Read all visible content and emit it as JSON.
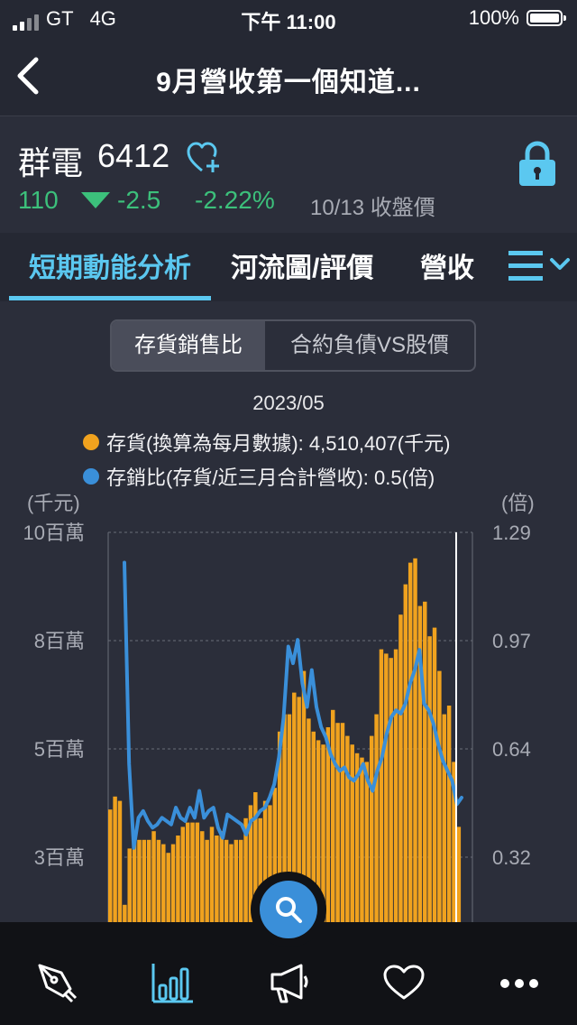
{
  "status_bar": {
    "carrier": "GT",
    "network": "4G",
    "time": "下午 11:00",
    "battery": "100%"
  },
  "nav": {
    "title": "9月營收第一個知道..."
  },
  "stock": {
    "name": "群電",
    "code": "6412",
    "price": "110",
    "change": "-2.5",
    "change_pct": "-2.22%",
    "date_label": "10/13 收盤價",
    "down_color": "#3cc07b"
  },
  "tabs": [
    {
      "label": "短期動能分析",
      "active": true
    },
    {
      "label": "河流圖/評價",
      "active": false
    },
    {
      "label": "營收",
      "active": false
    }
  ],
  "segment": {
    "options": [
      "存貨銷售比",
      "合約負債VS股價"
    ],
    "selected": "存貨銷售比"
  },
  "chart_data": {
    "type": "bar",
    "info": {
      "date": "2023/05",
      "legend": [
        {
          "label": "存貨(換算為每月數據): 4,510,407(千元)",
          "color": "#f0a21e"
        },
        {
          "label": "存銷比(存貨/近三月合計營收): 0.5(倍)",
          "color": "#3a8fd9"
        }
      ]
    },
    "y_left": {
      "unit": "(千元)",
      "ticks": [
        "10百萬",
        "8百萬",
        "5百萬",
        "3百萬"
      ],
      "range": [
        0,
        10000000
      ]
    },
    "y_right": {
      "unit": "(倍)",
      "ticks": [
        "1.29",
        "0.97",
        "0.64",
        "0.32"
      ],
      "range": [
        0,
        1.29
      ]
    },
    "grid": true,
    "series": [
      {
        "name": "存貨(換算為每月數據)",
        "kind": "bar",
        "color": "#f0a21e",
        "values": [
          3600000,
          3900000,
          3800000,
          1400000,
          2700000,
          3000000,
          2900000,
          2900000,
          2900000,
          3100000,
          2900000,
          2800000,
          2600000,
          2800000,
          3000000,
          3200000,
          3300000,
          3300000,
          3300000,
          3100000,
          2900000,
          3200000,
          3000000,
          3100000,
          2900000,
          2800000,
          2900000,
          2900000,
          3400000,
          3700000,
          4000000,
          3400000,
          3800000,
          3700000,
          4100000,
          5400000,
          5800000,
          5800000,
          6300000,
          6200000,
          6800000,
          5700000,
          5400000,
          5200000,
          5100000,
          5500000,
          5900000,
          5600000,
          5600000,
          5300000,
          5100000,
          4900000,
          4800000,
          4700000,
          5300000,
          5800000,
          7300000,
          7200000,
          7100000,
          7300000,
          8100000,
          8800000,
          9300000,
          9400000,
          8300000,
          8400000,
          7600000,
          7800000,
          6800000,
          5800000,
          6000000,
          4700000,
          3200000
        ]
      },
      {
        "name": "存銷比(存貨/近三月合計營收)",
        "kind": "line",
        "color": "#3a8fd9",
        "values": [
          1.2,
          0.6,
          0.35,
          0.44,
          0.46,
          0.43,
          0.41,
          0.42,
          0.44,
          0.43,
          0.42,
          0.47,
          0.44,
          0.43,
          0.47,
          0.44,
          0.52,
          0.44,
          0.46,
          0.47,
          0.41,
          0.38,
          0.45,
          0.44,
          0.43,
          0.42,
          0.39,
          0.43,
          0.44,
          0.46,
          0.47,
          0.5,
          0.54,
          0.62,
          0.74,
          0.95,
          0.9,
          0.97,
          0.84,
          0.77,
          0.88,
          0.77,
          0.71,
          0.68,
          0.63,
          0.6,
          0.58,
          0.59,
          0.56,
          0.55,
          0.57,
          0.6,
          0.55,
          0.52,
          0.58,
          0.62,
          0.69,
          0.74,
          0.76,
          0.75,
          0.78,
          0.84,
          0.88,
          0.94,
          0.78,
          0.76,
          0.72,
          0.66,
          0.61,
          0.58,
          0.55,
          0.48,
          0.5
        ]
      }
    ]
  },
  "bottom_nav": [
    {
      "icon": "pen-nib-icon"
    },
    {
      "icon": "bar-chart-icon",
      "active_color": "#5bc8f0"
    },
    {
      "icon": "megaphone-icon"
    },
    {
      "icon": "heart-icon"
    },
    {
      "icon": "more-dots-icon"
    }
  ],
  "fab": {
    "icon": "search-icon",
    "color": "#3a8fd9"
  }
}
